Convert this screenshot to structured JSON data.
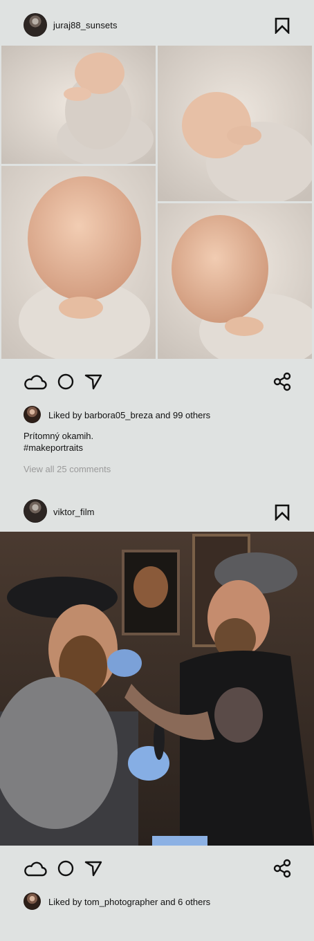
{
  "posts": [
    {
      "username": "juraj88_sunsets",
      "liked_by_text": "Liked by barbora05_breza and 99 others",
      "caption_line1": "Prítomný okamih.",
      "caption_line2": "#makeportraits",
      "comments_link": "View all 25 comments"
    },
    {
      "username": "viktor_film",
      "liked_by_text": "Liked by tom_photographer and 6 others"
    }
  ],
  "icons": {
    "bookmark": "bookmark-icon",
    "like": "cloud-like-icon",
    "comment": "circle-comment-icon",
    "share_send": "send-triangle-icon",
    "share": "share-nodes-icon"
  },
  "colors": {
    "background": "#dfe2e1",
    "comments_gray": "#9a9a9a",
    "text": "#111111"
  }
}
